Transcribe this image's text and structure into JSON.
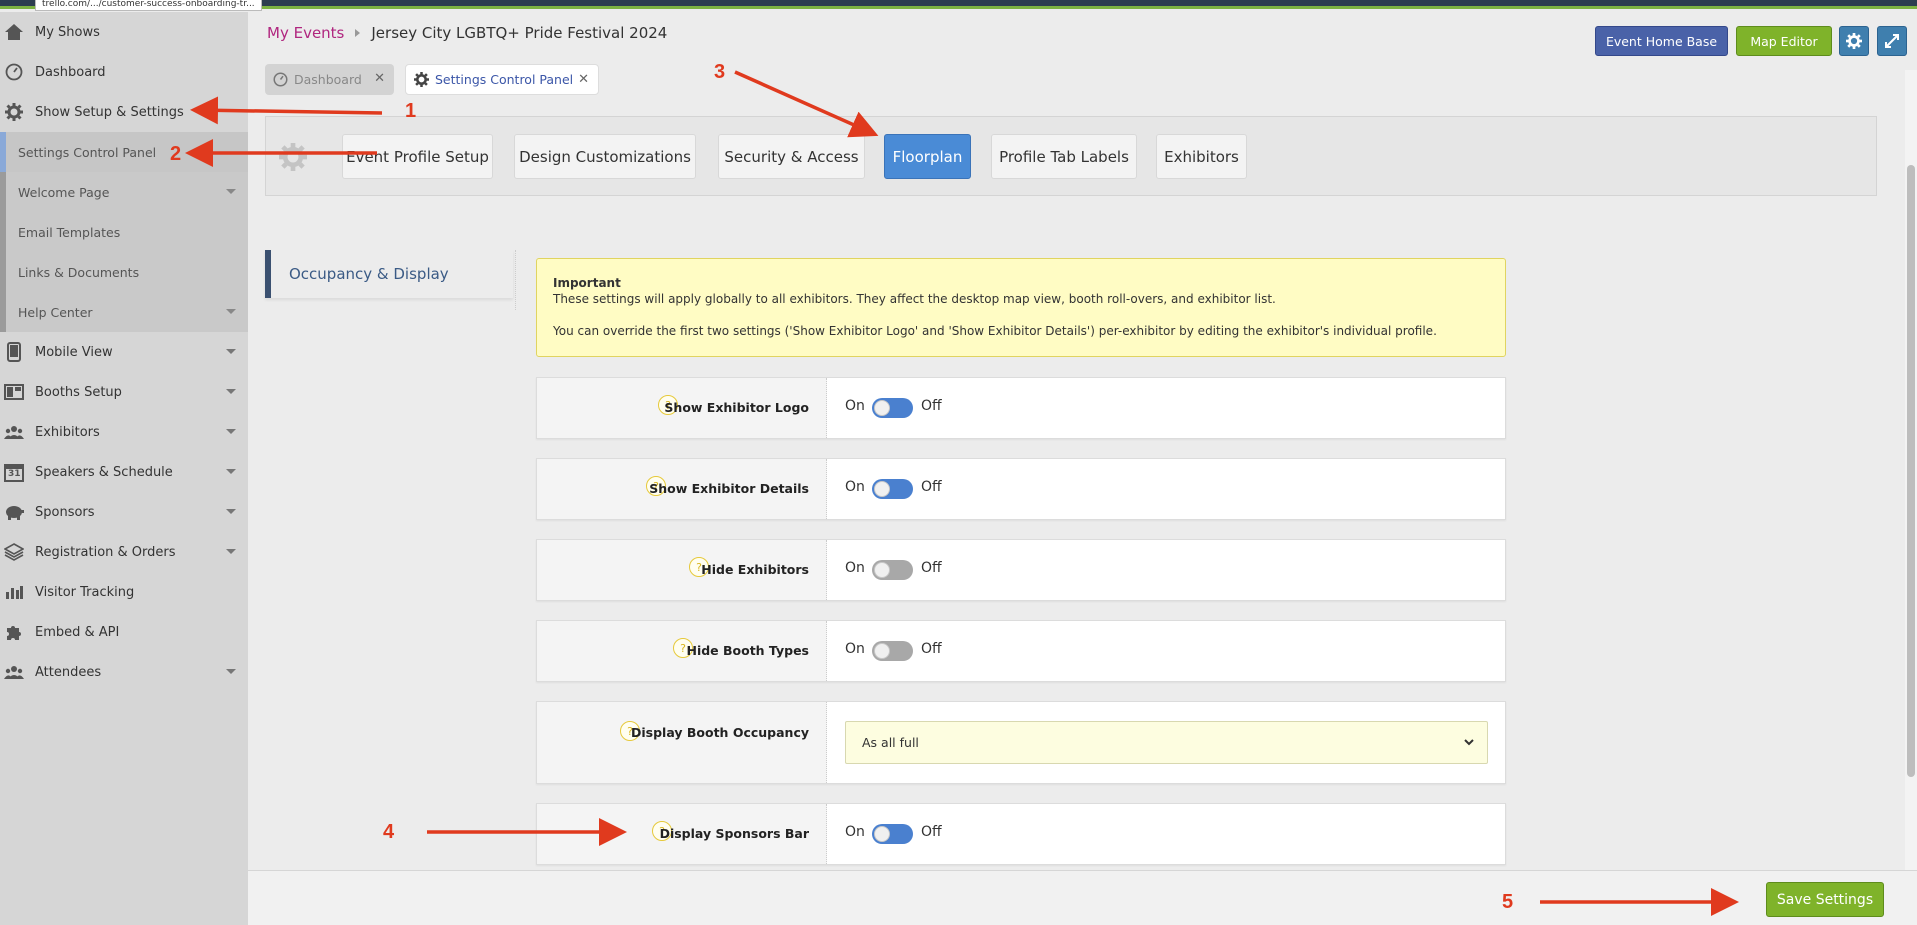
{
  "browser": {
    "url_tooltip": "trello.com/.../customer-success-onboarding-tr..."
  },
  "sidebar": {
    "items": [
      {
        "label": "My Shows",
        "icon": "home-icon"
      },
      {
        "label": "Dashboard",
        "icon": "dashboard-icon"
      },
      {
        "label": "Show Setup & Settings",
        "icon": "gear-icon"
      },
      {
        "label": "Mobile View",
        "icon": "tablet-icon"
      },
      {
        "label": "Booths Setup",
        "icon": "booths-icon"
      },
      {
        "label": "Exhibitors",
        "icon": "people-icon"
      },
      {
        "label": "Speakers & Schedule",
        "icon": "calendar-icon",
        "icon_text": "31"
      },
      {
        "label": "Sponsors",
        "icon": "piggy-bank-icon"
      },
      {
        "label": "Registration & Orders",
        "icon": "layers-icon"
      },
      {
        "label": "Visitor Tracking",
        "icon": "bar-chart-icon"
      },
      {
        "label": "Embed & API",
        "icon": "puzzle-icon"
      },
      {
        "label": "Attendees",
        "icon": "people-icon"
      }
    ],
    "subitems": [
      {
        "label": "Settings Control Panel"
      },
      {
        "label": "Welcome Page"
      },
      {
        "label": "Email Templates"
      },
      {
        "label": "Links & Documents"
      },
      {
        "label": "Help Center"
      }
    ]
  },
  "header": {
    "breadcrumb_link": "My Events",
    "event_title": "Jersey City LGBTQ+ Pride Festival 2024",
    "btn_home": "Event Home Base",
    "btn_map": "Map Editor"
  },
  "page_tabs": [
    {
      "label": "Dashboard"
    },
    {
      "label": "Settings Control Panel"
    }
  ],
  "settings_tabs": [
    {
      "label": "Event Profile Setup"
    },
    {
      "label": "Design Customizations"
    },
    {
      "label": "Security & Access"
    },
    {
      "label": "Floorplan",
      "active": true
    },
    {
      "label": "Profile Tab Labels"
    },
    {
      "label": "Exhibitors"
    }
  ],
  "section_nav": {
    "label": "Occupancy & Display"
  },
  "info_box": {
    "title": "Important",
    "line1": "These settings will apply globally to all exhibitors. They affect the desktop map view, booth roll-overs, and exhibitor list.",
    "line2": "You can override the first two settings ('Show Exhibitor Logo' and 'Show Exhibitor Details') per-exhibitor by editing the exhibitor's individual profile."
  },
  "settings": [
    {
      "label": "Show Exhibitor Logo",
      "type": "toggle",
      "state": "on",
      "on_text": "On",
      "off_text": "Off",
      "help": "?"
    },
    {
      "label": "Show Exhibitor Details",
      "type": "toggle",
      "state": "on",
      "on_text": "On",
      "off_text": "Off",
      "help": "?"
    },
    {
      "label": "Hide Exhibitors",
      "type": "toggle",
      "state": "off",
      "on_text": "On",
      "off_text": "Off",
      "help": "?"
    },
    {
      "label": "Hide Booth Types",
      "type": "toggle",
      "state": "off",
      "on_text": "On",
      "off_text": "Off",
      "help": "?"
    },
    {
      "label": "Display Booth Occupancy",
      "type": "select",
      "value": "As all full",
      "help": "?"
    },
    {
      "label": "Display Sponsors Bar",
      "type": "toggle",
      "state": "on",
      "on_text": "On",
      "off_text": "Off",
      "help": "?"
    }
  ],
  "footer": {
    "save_label": "Save Settings"
  },
  "annotations": {
    "numbers": [
      "1",
      "2",
      "3",
      "4",
      "5"
    ],
    "color": "#e03a1e"
  },
  "colors": {
    "primary_blue": "#4a8bd6",
    "accent_green": "#7fb32a",
    "link_magenta": "#b0267f",
    "info_yellow": "#fffcc4"
  }
}
